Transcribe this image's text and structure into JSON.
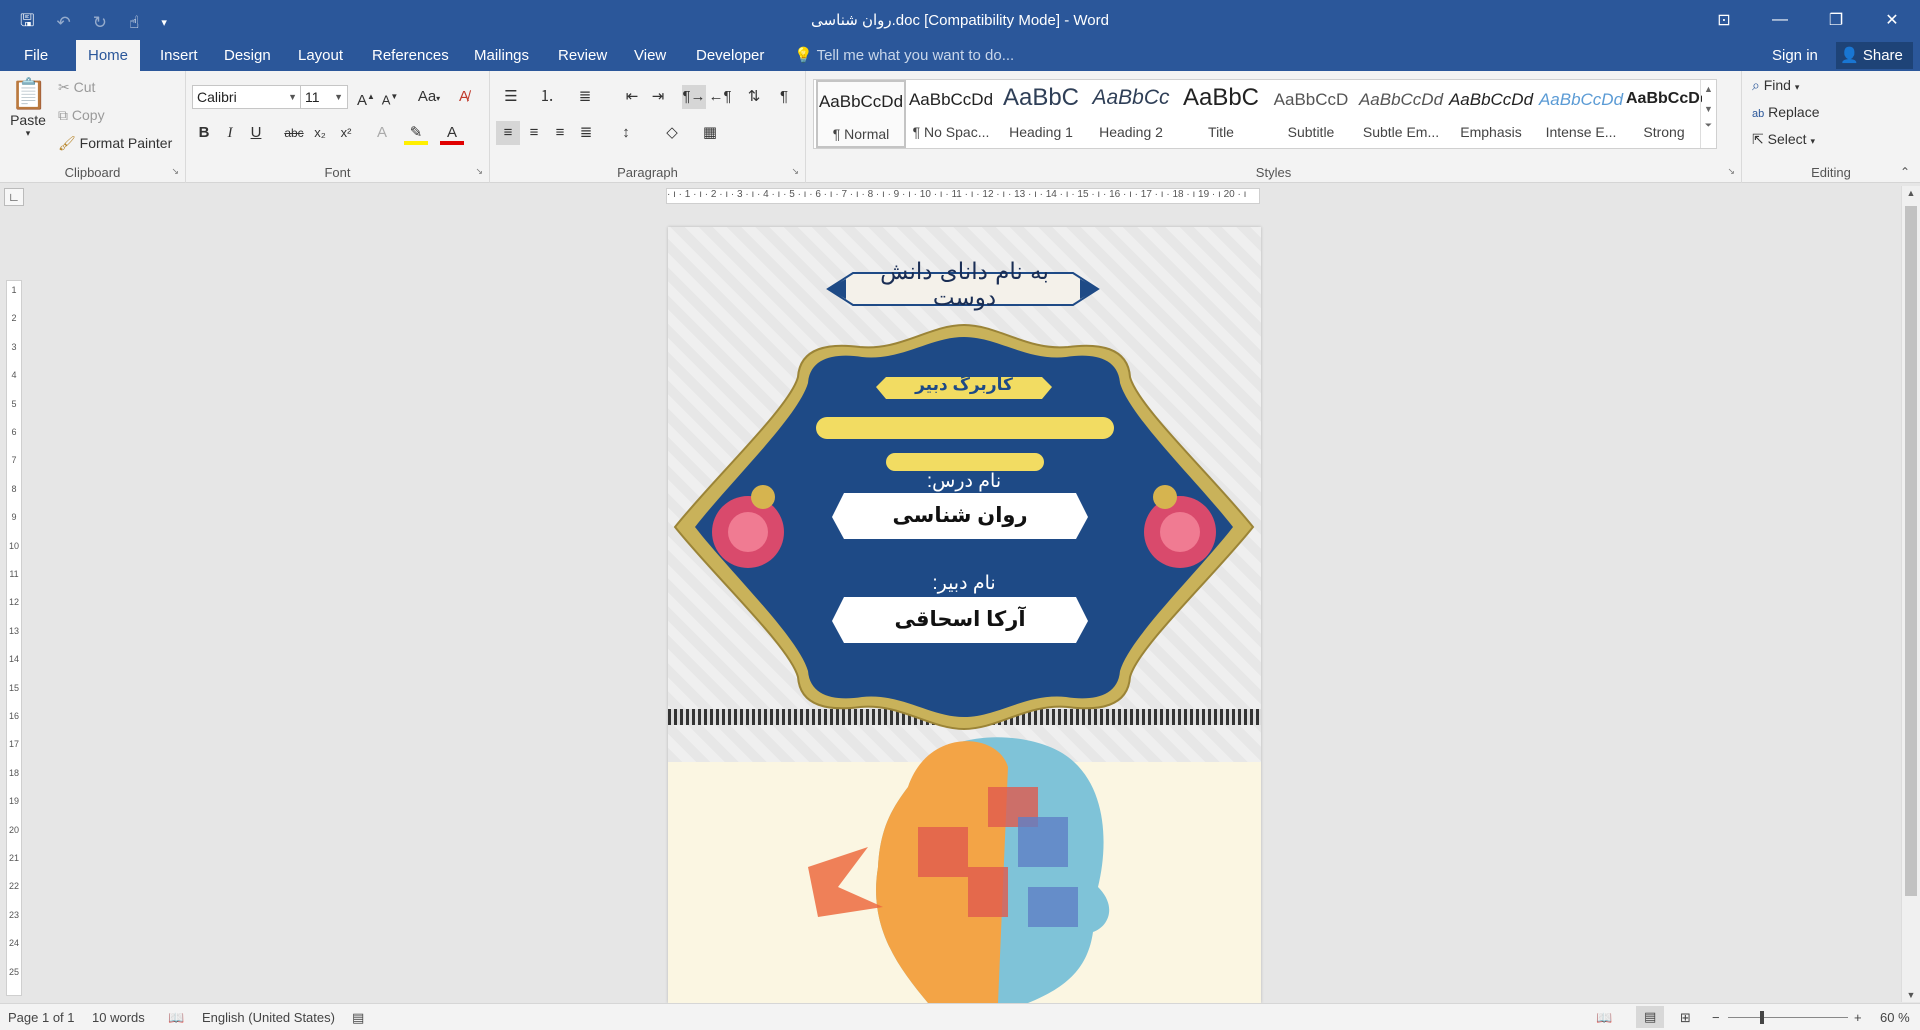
{
  "window": {
    "title": "روان شناسی.doc [Compatibility Mode] - Word",
    "qat": {
      "save_icon": "save-icon",
      "undo_icon": "undo-icon",
      "redo_icon": "redo-icon",
      "touch_icon": "touch-mode-icon"
    },
    "controls": [
      "ribbon-display-icon",
      "minimize-icon",
      "restore-icon",
      "close-icon"
    ]
  },
  "tabs": {
    "items": [
      "File",
      "Home",
      "Insert",
      "Design",
      "Layout",
      "References",
      "Mailings",
      "Review",
      "View",
      "Developer"
    ],
    "active": "Home",
    "tell_me": "Tell me what you want to do...",
    "sign_in": "Sign in",
    "share": "Share"
  },
  "ribbon": {
    "clipboard": {
      "label": "Clipboard",
      "paste": "Paste",
      "cut": "Cut",
      "copy": "Copy",
      "format_painter": "Format Painter"
    },
    "font": {
      "label": "Font",
      "font_name": "Calibri",
      "font_size": "11",
      "case": "Aa"
    },
    "paragraph": {
      "label": "Paragraph"
    },
    "styles": {
      "label": "Styles",
      "items": [
        {
          "sample": "AaBbCcDd",
          "name": "¶ Normal"
        },
        {
          "sample": "AaBbCcDd",
          "name": "¶ No Spac..."
        },
        {
          "sample": "AaBbC",
          "name": "Heading 1"
        },
        {
          "sample": "AaBbCc",
          "name": "Heading 2"
        },
        {
          "sample": "AaBbC",
          "name": "Title"
        },
        {
          "sample": "AaBbCcD",
          "name": "Subtitle"
        },
        {
          "sample": "AaBbCcDd",
          "name": "Subtle Em..."
        },
        {
          "sample": "AaBbCcDd",
          "name": "Emphasis"
        },
        {
          "sample": "AaBbCcDd",
          "name": "Intense E..."
        },
        {
          "sample": "AaBbCcDc",
          "name": "Strong"
        }
      ]
    },
    "editing": {
      "label": "Editing",
      "find": "Find",
      "replace": "Replace",
      "select": "Select"
    }
  },
  "document": {
    "header_calligraphy": "به نام دانای دانش دوست",
    "badge": "کاربرگ دبیر",
    "lesson_label": "نام درس:",
    "lesson_value": "روان شناسی",
    "teacher_label": "نام دبیر:",
    "teacher_value": "آرکا اسحاقی"
  },
  "ruler": {
    "horizontal": "· ı · 1 · ı · 2 · ı · 3 · ı · 4 · ı · 5 · ı · 6 · ı · 7 · ı · 8 · ı · 9 · ı · 10 · ı · 11 · ı · 12 · ı · 13 · ı · 14 · ı · 15 · ı · 16 · ı · 17 · ı · 18 · ı 19 · ı 20 · ı",
    "vertical": [
      "1",
      "2",
      "3",
      "4",
      "5",
      "6",
      "7",
      "8",
      "9",
      "10",
      "11",
      "12",
      "13",
      "14",
      "15",
      "16",
      "17",
      "18",
      "19",
      "20",
      "21",
      "22",
      "23",
      "24",
      "25"
    ]
  },
  "status": {
    "page": "Page 1 of 1",
    "words": "10 words",
    "language": "English (United States)",
    "zoom": "60 %"
  },
  "colors": {
    "accent": "#2b579a",
    "panel_blue": "#1e4a86",
    "gold": "#c9b25a",
    "badge_yellow": "#f2dc62",
    "page_cream": "#fbf6e2"
  }
}
